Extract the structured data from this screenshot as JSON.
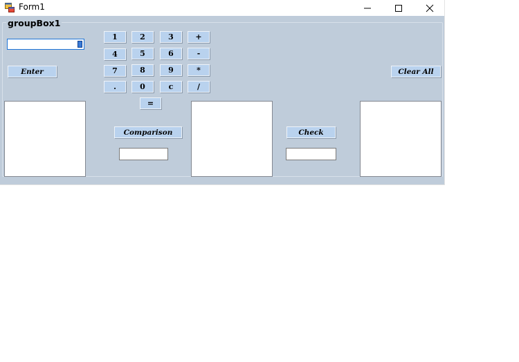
{
  "window": {
    "title": "Form1",
    "icon": "winforms-app-icon",
    "controls": [
      "minimize-icon",
      "maximize-icon",
      "close-icon"
    ]
  },
  "group": {
    "title": "groupBox1"
  },
  "display": {
    "value": ""
  },
  "keypad": {
    "k1": "1",
    "k2": "2",
    "k3": "3",
    "plus": "+",
    "k4": "4",
    "k5": "5",
    "k6": "6",
    "minus": "-",
    "k7": "7",
    "k8": "8",
    "k9": "9",
    "multiply": "*",
    "dot": ".",
    "k0": "0",
    "clear": "c",
    "divide": "/",
    "equals": "="
  },
  "buttons": {
    "enter": "Enter",
    "clear_all": "Clear All",
    "comparison": "Comparison",
    "check": "Check"
  },
  "fields": {
    "comparison_result": "",
    "check_result": ""
  },
  "colors": {
    "client_bg": "#bfccda",
    "button_bg": "#b9d2ee",
    "focus_border": "#1e74d8"
  }
}
